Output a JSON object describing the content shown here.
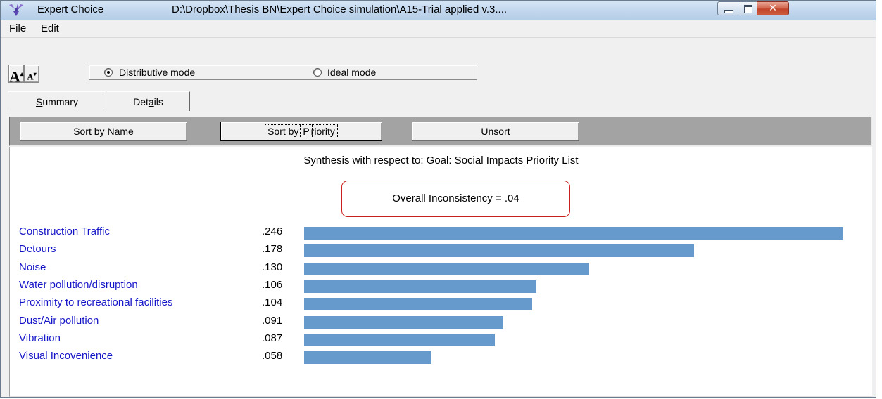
{
  "window": {
    "app_name": "Expert Choice",
    "path": "D:\\Dropbox\\Thesis BN\\Expert Choice simulation\\A15-Trial applied v.3....",
    "controls": {
      "minimize": "minimize-icon",
      "maximize": "maximize-icon",
      "close": "close-icon"
    }
  },
  "menu": [
    {
      "label": "File"
    },
    {
      "label": "Edit"
    }
  ],
  "toolbar": {
    "font_increase": "A",
    "font_decrease": "A",
    "modes": [
      {
        "label": "Distributive mode",
        "selected": true
      },
      {
        "label": "Ideal mode",
        "selected": false
      }
    ]
  },
  "tabs": [
    {
      "label": "Summary",
      "active": true
    },
    {
      "label": "Details",
      "active": false
    }
  ],
  "sort_buttons": [
    {
      "label": "Sort by Name",
      "focused": false
    },
    {
      "label": "Sort by Priority",
      "focused": true
    },
    {
      "label": "Unsort",
      "focused": false
    }
  ],
  "synthesis": {
    "title": "Synthesis with respect to: Goal: Social Impacts Priority List",
    "inconsistency_label": "Overall Inconsistency = .04",
    "bar_color": "#6699cc",
    "highlight_color": "#cc1f1f"
  },
  "chart_data": {
    "type": "bar",
    "categories": [
      "Construction Traffic",
      "Detours",
      "Noise",
      "Water pollution/disruption",
      "Proximity to recreational facilities",
      "Dust/Air pollution",
      "Vibration",
      "Visual Incovenience"
    ],
    "values": [
      0.246,
      0.178,
      0.13,
      0.106,
      0.104,
      0.091,
      0.087,
      0.058
    ],
    "value_labels": [
      ".246",
      ".178",
      ".130",
      ".106",
      ".104",
      ".091",
      ".087",
      ".058"
    ]
  }
}
